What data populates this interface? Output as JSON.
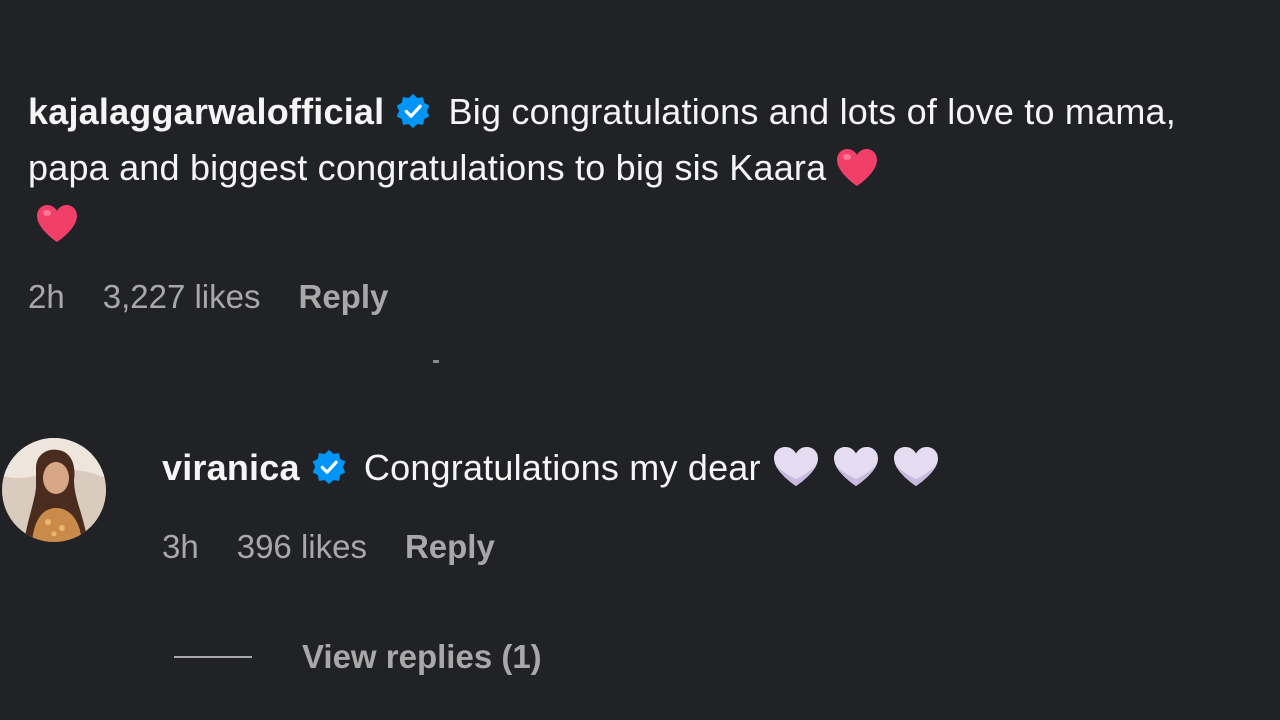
{
  "comments": [
    {
      "username": "kajalaggarwalofficial",
      "verified": true,
      "text": "Big congratulations and lots of love to mama, papa and biggest congratulations to big sis Kaara",
      "emojis": [
        "red-heart",
        "red-heart"
      ],
      "time": "2h",
      "likes": "3,227 likes",
      "reply_label": "Reply"
    },
    {
      "username": "viranica",
      "verified": true,
      "text": "Congratulations my dear",
      "emojis": [
        "white-heart",
        "white-heart",
        "white-heart"
      ],
      "time": "3h",
      "likes": "396 likes",
      "reply_label": "Reply",
      "view_replies_label": "View replies (1)"
    }
  ],
  "colors": {
    "background": "#212226",
    "text": "#f5f5f5",
    "secondary": "#a8a8a8",
    "verified": "#0095f6",
    "red_heart": "#f0406a",
    "white_heart": "#e6dcf2"
  }
}
